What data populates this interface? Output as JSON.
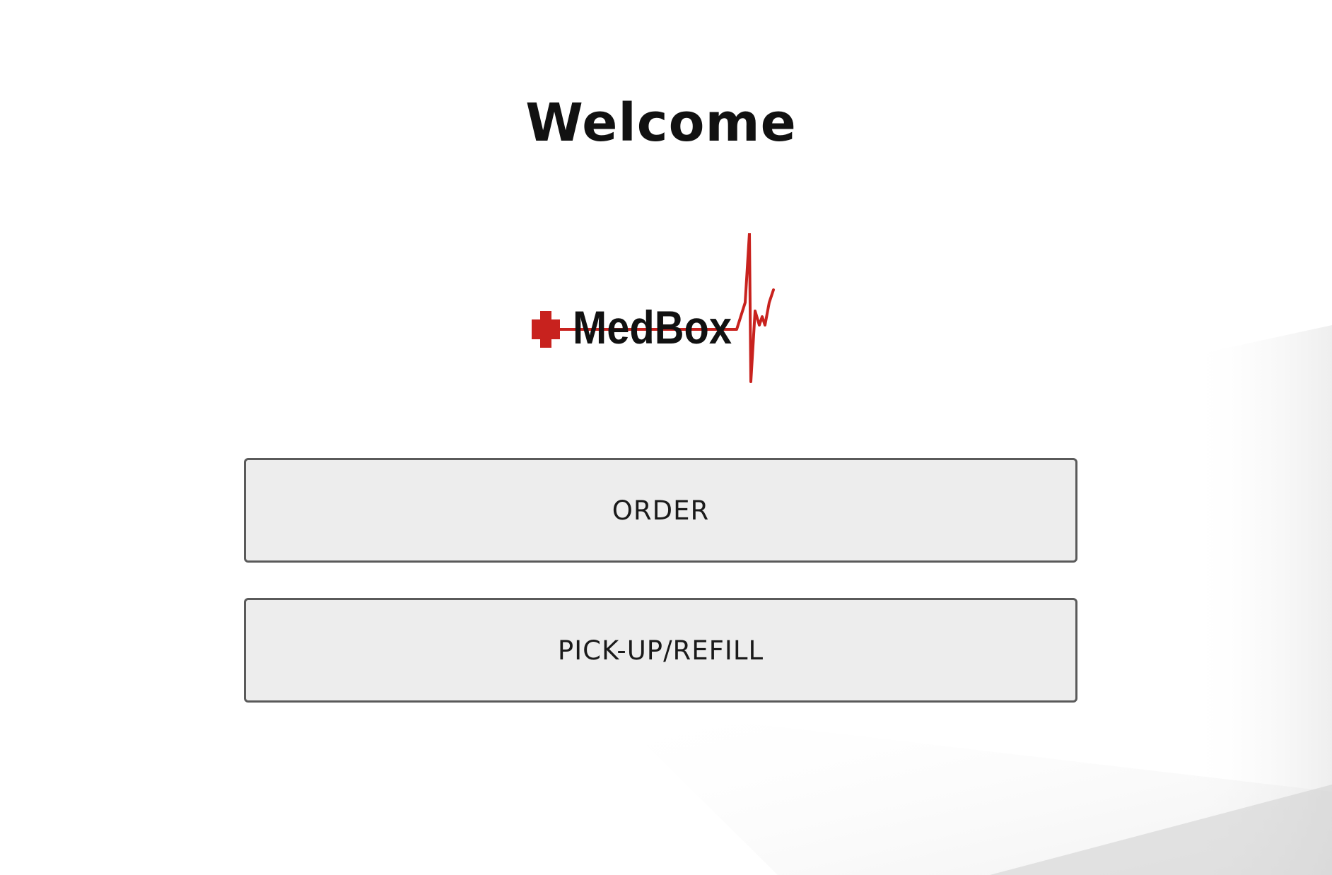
{
  "header": {
    "title": "Welcome"
  },
  "logo": {
    "text": "MedBox",
    "icon": "medical-cross-heartbeat-logo",
    "accent_color": "#c8221e"
  },
  "actions": {
    "order_label": "ORDER",
    "pickup_label": "PICK-UP/REFILL"
  },
  "theme": {
    "background": "#ffffff",
    "button_background": "#ededed",
    "button_border": "#5a5a5a",
    "text_color": "#111111"
  }
}
